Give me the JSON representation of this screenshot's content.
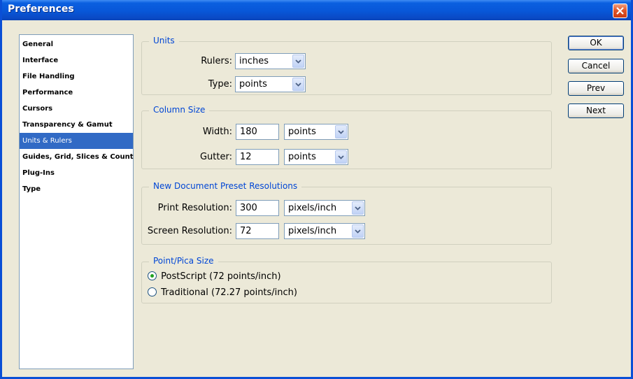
{
  "window": {
    "title": "Preferences"
  },
  "categories": [
    "General",
    "Interface",
    "File Handling",
    "Performance",
    "Cursors",
    "Transparency & Gamut",
    "Units & Rulers",
    "Guides, Grid, Slices & Count",
    "Plug-Ins",
    "Type"
  ],
  "selected_category": "Units & Rulers",
  "units": {
    "legend": "Units",
    "rulers_label": "Rulers:",
    "rulers_value": "inches",
    "type_label": "Type:",
    "type_value": "points"
  },
  "column_size": {
    "legend": "Column Size",
    "width_label": "Width:",
    "width_value": "180",
    "width_unit": "points",
    "gutter_label": "Gutter:",
    "gutter_value": "12",
    "gutter_unit": "points"
  },
  "resolutions": {
    "legend": "New Document Preset Resolutions",
    "print_label": "Print Resolution:",
    "print_value": "300",
    "print_unit": "pixels/inch",
    "screen_label": "Screen Resolution:",
    "screen_value": "72",
    "screen_unit": "pixels/inch"
  },
  "pica": {
    "legend": "Point/Pica Size",
    "postscript_label": "PostScript (72 points/inch)",
    "postscript_selected": true,
    "traditional_label": "Traditional (72.27 points/inch)",
    "traditional_selected": false
  },
  "buttons": {
    "ok": "OK",
    "cancel": "Cancel",
    "prev": "Prev",
    "next": "Next"
  },
  "colors": {
    "titlebar": "#0a5fe0",
    "selection": "#316ac5",
    "legend_text": "#0046d5",
    "dialog_bg": "#ece9d8"
  },
  "icons": {
    "close": "close-icon",
    "dropdown": "chevron-down-icon",
    "radio": "radio-button"
  }
}
